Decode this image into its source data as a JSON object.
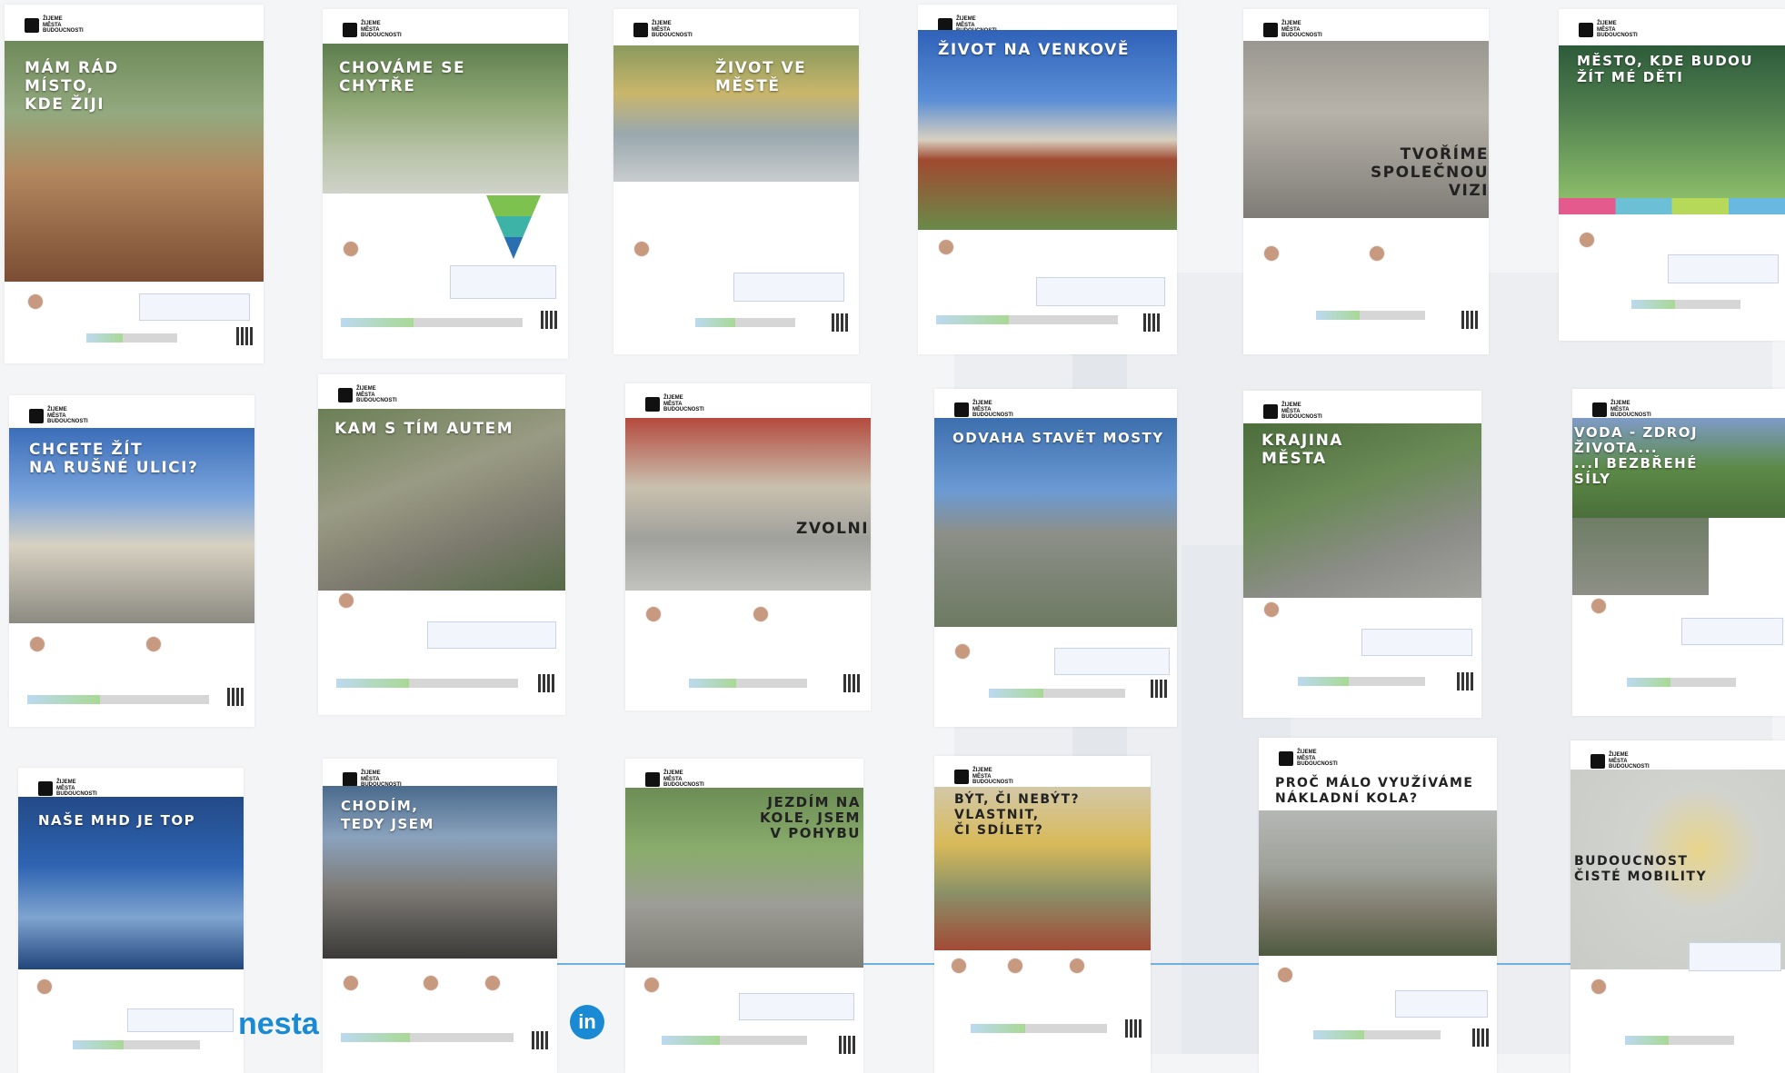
{
  "brand_text": "ŽIJEME\nMĚSTA\nBUDOUCNOSTI",
  "overlay": {
    "nesta": "nesta",
    "linkedin": "in"
  },
  "posters": [
    {
      "title": "MÁM RÁD\nMÍSTO,\nKDE ŽIJI"
    },
    {
      "title": "CHOVÁME SE\nCHYTŘE"
    },
    {
      "title": "ŽIVOT VE MĚSTĚ"
    },
    {
      "title": "ŽIVOT NA VENKOVĚ"
    },
    {
      "title": "TVOŘÍME\nSPOLEČNOU VIZI"
    },
    {
      "title": "MĚSTO, KDE BUDOU\nŽÍT MÉ DĚTI"
    },
    {
      "title": "CHCETE ŽÍT\nNA RUŠNÉ ULICI?"
    },
    {
      "title": "KAM S TÍM AUTEM"
    },
    {
      "title": "ZVOLNI"
    },
    {
      "title": "ODVAHA STAVĚT MOSTY"
    },
    {
      "title": "KRAJINA\nMĚSTA"
    },
    {
      "title": "VODA - ZDROJ\nŽIVOTA...\n...I BEZBŘEHÉ\nSÍLY"
    },
    {
      "title": "NAŠE MHD JE TOP"
    },
    {
      "title": "CHODÍM,\nTEDY JSEM"
    },
    {
      "title": "JEZDÍM NA\nKOLE, JSEM\nV POHYBU"
    },
    {
      "title": "BÝT, ČI NEBÝT?\nVLASTNIT,\nČI SDÍLET?"
    },
    {
      "title": "PROČ MÁLO VYUŽÍVÁME\nNÁKLADNÍ KOLA?"
    },
    {
      "title": "BUDOUCNOST\nČISTÉ MOBILITY"
    }
  ],
  "colors": {
    "accent_blue": "#1a8ad4",
    "eco_green": "#6fbf4e"
  }
}
